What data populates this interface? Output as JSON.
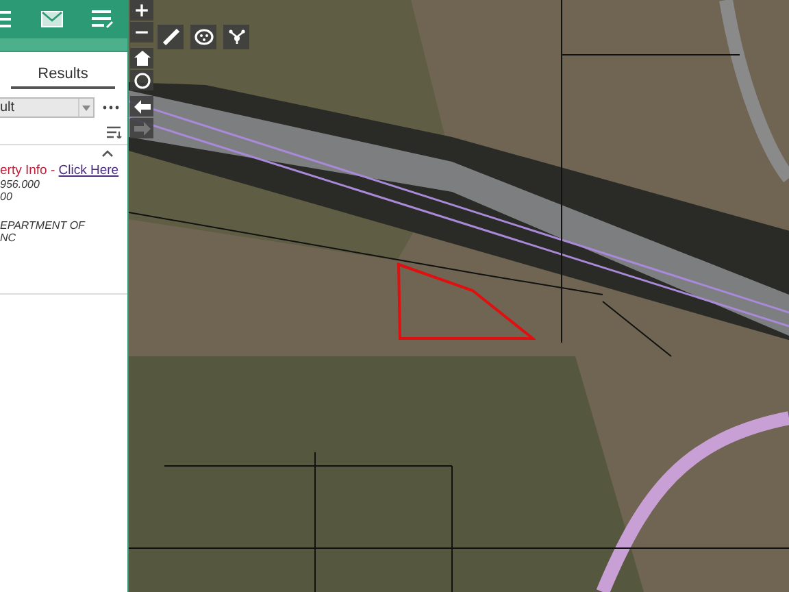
{
  "panel": {
    "tabs": [
      {
        "label": "Results",
        "selected": true
      }
    ],
    "dropdown": {
      "value": "ult"
    },
    "result": {
      "expanded": true,
      "title": "erty Info",
      "separator": " - ",
      "link": "Click Here",
      "lines": [
        {
          "text": "956.000",
          "gap": false
        },
        {
          "text": "00",
          "gap": false
        },
        {
          "text": "EPARTMENT OF",
          "gap": true
        },
        {
          "text": "NC",
          "gap": false
        }
      ]
    }
  },
  "map_tools": {
    "zoom_in": "+",
    "zoom_out": "−",
    "forward_disabled": true
  }
}
